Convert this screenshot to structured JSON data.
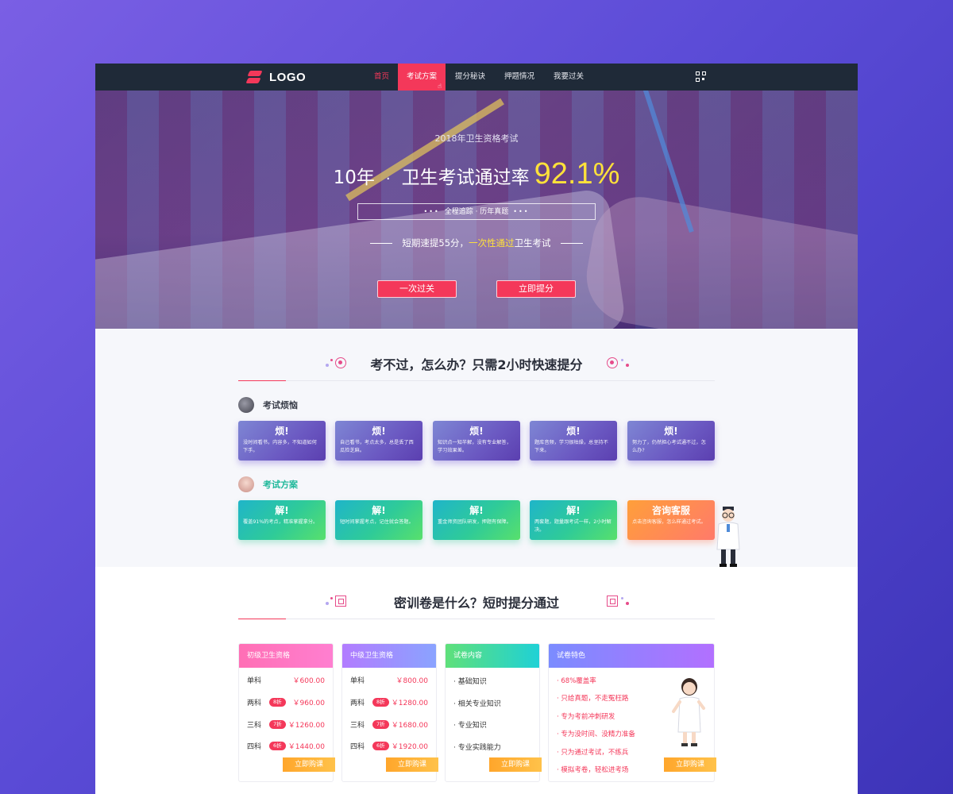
{
  "nav": {
    "logo_text": "LOGO",
    "items": [
      {
        "label": "首页"
      },
      {
        "label": "考试方案"
      },
      {
        "label": "提分秘诀"
      },
      {
        "label": "押题情况"
      },
      {
        "label": "我要过关"
      }
    ],
    "active_index": 1
  },
  "hero": {
    "subtitle": "2018年卫生资格考试",
    "title_prefix": "10年",
    "title_dot": "·",
    "title_main": "卫生考试通过率",
    "title_rate": "92.1%",
    "box_dots_left": "•••",
    "box_text": "全程追踪 · 历年真题",
    "box_dots_right": "•••",
    "line_part1": "短期速提55分，",
    "line_highlight": "一次性通过",
    "line_part2": "卫生考试",
    "btn_pass": "一次过关",
    "btn_boost": "立即提分"
  },
  "section1": {
    "title": "考不过，怎么办？只需2小时快速提分",
    "worry_label": "考试烦恼",
    "worry_cards": [
      {
        "title": "烦!",
        "desc": "没时间看书，内容多，不知道如何下手。"
      },
      {
        "title": "烦!",
        "desc": "自己看书，考点太多，总是丢了西瓜捡芝麻。"
      },
      {
        "title": "烦!",
        "desc": "知识点一知半解，没有专业解答，学习效果差。"
      },
      {
        "title": "烦!",
        "desc": "题库音频，学习很枯燥，总坚持不下来。"
      },
      {
        "title": "烦!",
        "desc": "努力了，仍然担心考试通不过，怎么办?"
      }
    ],
    "plan_label": "考试方案",
    "plan_cards": [
      {
        "title": "解!",
        "desc": "覆盖91%的考点，精准掌握拿分。"
      },
      {
        "title": "解!",
        "desc": "短时间掌握考点，记住就会答题。"
      },
      {
        "title": "解!",
        "desc": "重金师资团队研发，押题有保障。"
      },
      {
        "title": "解!",
        "desc": "两套题，题量跟考试一样，2小时解决。"
      },
      {
        "title": "咨询客服",
        "desc": "点击咨询客服，怎么样通过考试。"
      }
    ]
  },
  "section2": {
    "title": "密训卷是什么？短时提分通过",
    "primary": {
      "header": "初级卫生资格",
      "rows": [
        {
          "name": "单科",
          "tag": "",
          "price": "￥600.00"
        },
        {
          "name": "两科",
          "tag": "8折",
          "price": "￥960.00"
        },
        {
          "name": "三科",
          "tag": "7折",
          "price": "￥1260.00"
        },
        {
          "name": "四科",
          "tag": "6折",
          "price": "￥1440.00"
        }
      ],
      "buy": "立即购课"
    },
    "intermediate": {
      "header": "中级卫生资格",
      "rows": [
        {
          "name": "单科",
          "tag": "",
          "price": "￥800.00"
        },
        {
          "name": "两科",
          "tag": "8折",
          "price": "￥1280.00"
        },
        {
          "name": "三科",
          "tag": "7折",
          "price": "￥1680.00"
        },
        {
          "name": "四科",
          "tag": "6折",
          "price": "￥1920.00"
        }
      ],
      "buy": "立即购课"
    },
    "content": {
      "header": "试卷内容",
      "items": [
        "· 基础知识",
        "· 相关专业知识",
        "· 专业知识",
        "· 专业实践能力"
      ],
      "buy": "立即购课"
    },
    "features": {
      "header": "试卷特色",
      "items": [
        "· 68%覆盖率",
        "· 只给真题，不走冤枉路",
        "· 专为考前冲刺研发",
        "· 专为没时间、没精力准备",
        "· 只为通过考试，不练兵",
        "· 模拟考卷，轻松进考场"
      ],
      "buy": "立即购课"
    }
  },
  "colors": {
    "accent": "#f4385a",
    "highlight": "#ffe13a",
    "nav_bg": "#1f2a38"
  }
}
